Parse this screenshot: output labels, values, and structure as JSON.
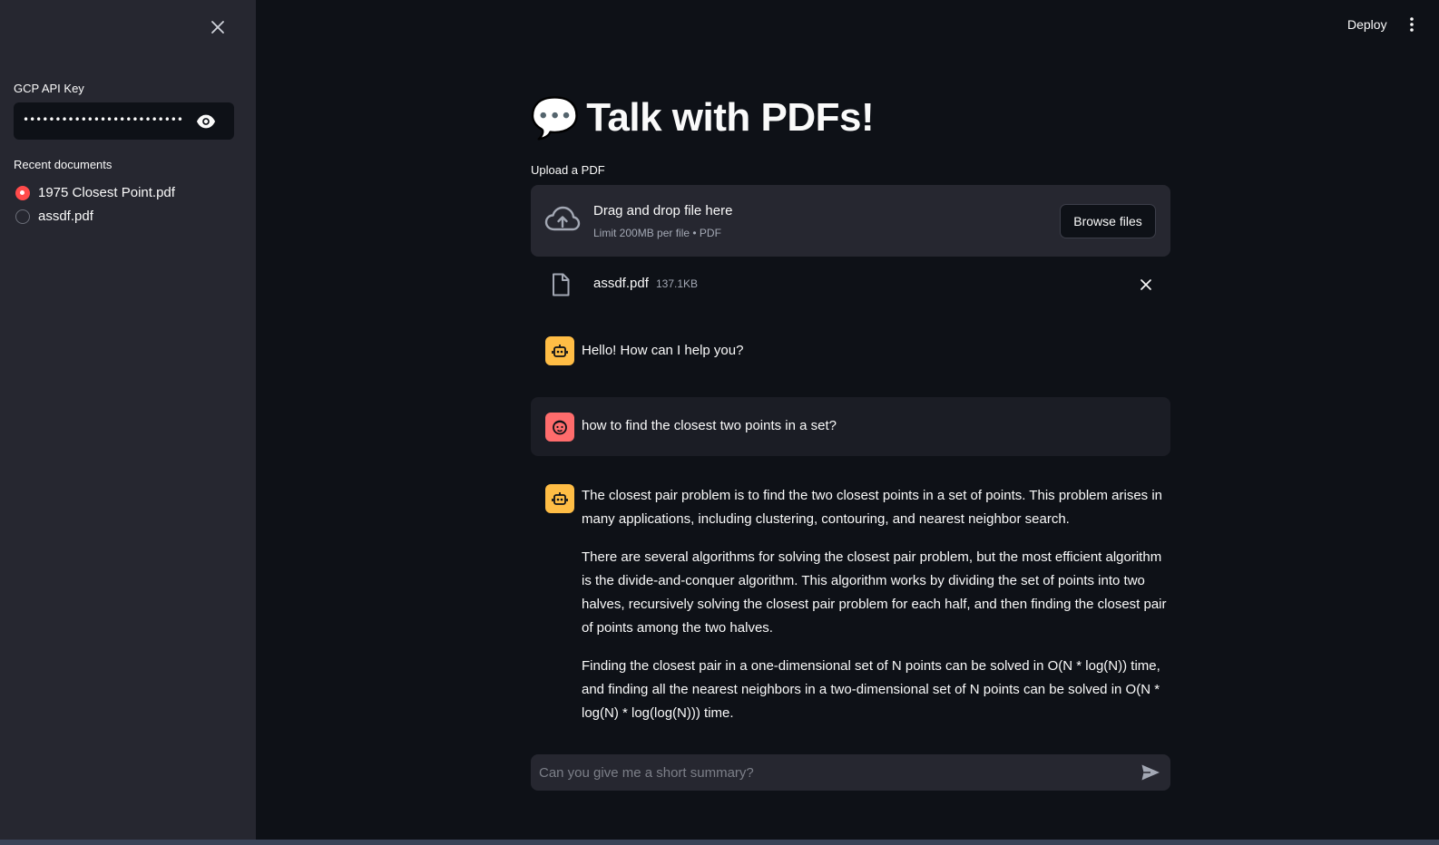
{
  "sidebar": {
    "api_key_label": "GCP API Key",
    "api_key_masked": "••••••••••••••••••••••••••••••••••••••",
    "recent_label": "Recent documents",
    "documents": [
      {
        "name": "1975 Closest Point.pdf",
        "selected": true
      },
      {
        "name": "assdf.pdf",
        "selected": false
      }
    ]
  },
  "header": {
    "deploy_label": "Deploy"
  },
  "main": {
    "title_emoji": "💬",
    "title": "Talk with PDFs!",
    "upload_label": "Upload a PDF",
    "dropzone": {
      "main_text": "Drag and drop file here",
      "sub_text": "Limit 200MB per file • PDF",
      "browse_label": "Browse files"
    },
    "uploaded_file": {
      "name": "assdf.pdf",
      "size": "137.1KB"
    },
    "messages": [
      {
        "role": "assistant",
        "paragraphs": [
          "Hello! How can I help you?"
        ]
      },
      {
        "role": "user",
        "paragraphs": [
          "how to find the closest two points in a set?"
        ]
      },
      {
        "role": "assistant",
        "paragraphs": [
          "The closest pair problem is to find the two closest points in a set of points. This problem arises in many applications, including clustering, contouring, and nearest neighbor search.",
          "There are several algorithms for solving the closest pair problem, but the most efficient algorithm is the divide-and-conquer algorithm. This algorithm works by dividing the set of points into two halves, recursively solving the closest pair problem for each half, and then finding the closest pair of points among the two halves.",
          "Finding the closest pair in a one-dimensional set of N points can be solved in O(N * log(N)) time, and finding all the nearest neighbors in a two-dimensional set of N points can be solved in O(N * log(N) * log(log(N))) time."
        ]
      }
    ],
    "chat_input_placeholder": "Can you give me a short summary?"
  },
  "colors": {
    "background": "#0e1117",
    "sidebar": "#262730",
    "accent": "#ff4b4b",
    "bot_avatar": "#ffbd45",
    "user_avatar": "#ff6c6c"
  }
}
